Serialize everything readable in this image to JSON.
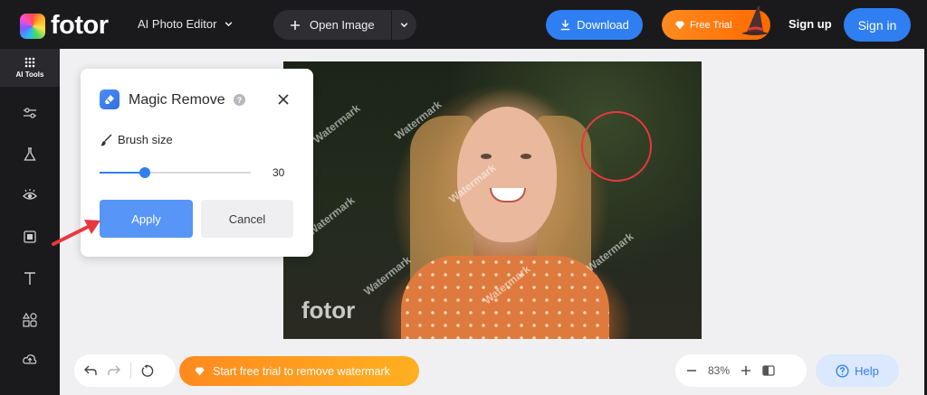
{
  "header": {
    "logo_text": "fotor",
    "editor_menu": "AI Photo Editor",
    "open_image": "Open Image",
    "download": "Download",
    "free_trial": "Free Trial",
    "sign_up": "Sign up",
    "sign_in": "Sign in"
  },
  "sidebar": {
    "active_label": "AI Tools",
    "items": [
      "ai-tools",
      "adjust",
      "beauty",
      "eye",
      "frame",
      "text",
      "elements",
      "upload"
    ]
  },
  "photo": {
    "watermark_text": "Watermark",
    "brand_watermark": "fotor"
  },
  "magic_remove": {
    "title": "Magic Remove",
    "help": "?",
    "brush_size_label": "Brush size",
    "brush_size_value": "30",
    "brush_size_fraction": 0.3,
    "apply": "Apply",
    "cancel": "Cancel"
  },
  "bottom": {
    "trial_banner": "Start free trial to remove watermark",
    "zoom": "83%",
    "help": "Help"
  },
  "colors": {
    "brand_blue": "#2f7ff2",
    "trial_orange": "#ff8a1f",
    "annotation_red": "#e8383f"
  }
}
